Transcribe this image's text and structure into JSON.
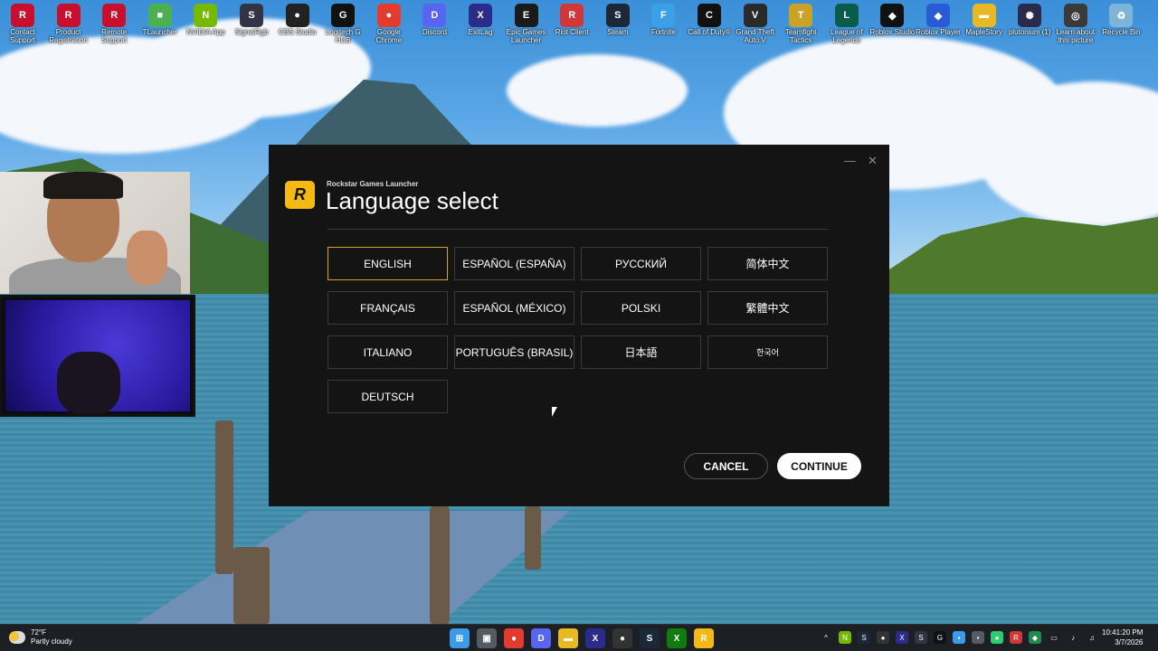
{
  "desktop_icons": [
    {
      "label": "Contact Support",
      "icon": "rockstar-icon",
      "color": "#c8102e",
      "glyph": "R"
    },
    {
      "label": "Product Registration",
      "icon": "rockstar-icon",
      "color": "#c8102e",
      "glyph": "R"
    },
    {
      "label": "Remote Support",
      "icon": "rockstar-icon",
      "color": "#c8102e",
      "glyph": "R"
    },
    {
      "label": "TLauncher",
      "icon": "tlauncher-icon",
      "color": "#4caf50",
      "glyph": "■"
    },
    {
      "label": "NVIDIA App",
      "icon": "nvidia-icon",
      "color": "#76b900",
      "glyph": "N"
    },
    {
      "label": "SignalRgb",
      "icon": "signalrgb-icon",
      "color": "#333344",
      "glyph": "S"
    },
    {
      "label": "OBS Studio",
      "icon": "obs-icon",
      "color": "#222222",
      "glyph": "●"
    },
    {
      "label": "Logitech G HUB",
      "icon": "logitech-icon",
      "color": "#111111",
      "glyph": "G"
    },
    {
      "label": "Google Chrome",
      "icon": "chrome-icon",
      "color": "#e33b2e",
      "glyph": "●"
    },
    {
      "label": "Discord",
      "icon": "discord-icon",
      "color": "#5865f2",
      "glyph": "D"
    },
    {
      "label": "ExitLag",
      "icon": "exitlag-icon",
      "color": "#2b2b8c",
      "glyph": "X"
    },
    {
      "label": "Epic Games Launcher",
      "icon": "epic-icon",
      "color": "#1a1a1a",
      "glyph": "E"
    },
    {
      "label": "Riot Client",
      "icon": "riot-icon",
      "color": "#d13639",
      "glyph": "R"
    },
    {
      "label": "Steam",
      "icon": "steam-icon",
      "color": "#1b2838",
      "glyph": "S"
    },
    {
      "label": "Fortnite",
      "icon": "fortnite-icon",
      "color": "#3aa0e8",
      "glyph": "F"
    },
    {
      "label": "Call of Duty®",
      "icon": "cod-icon",
      "color": "#111111",
      "glyph": "C"
    },
    {
      "label": "Grand Theft Auto V",
      "icon": "gta-icon",
      "color": "#2a2a2a",
      "glyph": "V"
    },
    {
      "label": "Teamfight Tactics",
      "icon": "tft-icon",
      "color": "#c9a227",
      "glyph": "T"
    },
    {
      "label": "League of Legends",
      "icon": "lol-icon",
      "color": "#0a5c4a",
      "glyph": "L"
    },
    {
      "label": "Roblox Studio",
      "icon": "roblox-studio-icon",
      "color": "#111111",
      "glyph": "◆"
    },
    {
      "label": "Roblox Player",
      "icon": "roblox-player-icon",
      "color": "#2a5bd7",
      "glyph": "◆"
    },
    {
      "label": "MapleStory",
      "icon": "folder-icon",
      "color": "#e8b923",
      "glyph": "▬"
    },
    {
      "label": "plutonium (1)",
      "icon": "plutonium-icon",
      "color": "#2a2a4a",
      "glyph": "✺"
    },
    {
      "label": "Learn about this picture",
      "icon": "learn-picture-icon",
      "color": "#3a3a3a",
      "glyph": "◎"
    },
    {
      "label": "Recycle Bin",
      "icon": "recycle-bin-icon",
      "color": "#7fb4d9",
      "glyph": "♻"
    }
  ],
  "launcher": {
    "app_name": "Rockstar Games Launcher",
    "title": "Language select",
    "logo_glyph": "R",
    "minimize_glyph": "—",
    "close_glyph": "✕",
    "accent_color": "#d4a52a",
    "selected_language": "ENGLISH",
    "languages": [
      "ENGLISH",
      "ESPAÑOL (ESPAÑA)",
      "РУССКИЙ",
      "简体中文",
      "FRANÇAIS",
      "ESPAÑOL (MÉXICO)",
      "POLSKI",
      "繁體中文",
      "ITALIANO",
      "PORTUGUÊS (BRASIL)",
      "日本語",
      "한국어",
      "DEUTSCH"
    ],
    "cancel_label": "CANCEL",
    "continue_label": "CONTINUE"
  },
  "taskbar": {
    "weather_temp": "72°F",
    "weather_desc": "Partly cloudy",
    "pinned": [
      {
        "name": "start-icon",
        "color": "#3b9be8",
        "glyph": "⊞"
      },
      {
        "name": "task-view-icon",
        "color": "#555b63",
        "glyph": "▣"
      },
      {
        "name": "chrome-icon",
        "color": "#e33b2e",
        "glyph": "●"
      },
      {
        "name": "discord-icon",
        "color": "#5865f2",
        "glyph": "D"
      },
      {
        "name": "file-explorer-icon",
        "color": "#e8b923",
        "glyph": "▬"
      },
      {
        "name": "exitlag-icon",
        "color": "#2b2b8c",
        "glyph": "X"
      },
      {
        "name": "obs-icon",
        "color": "#333333",
        "glyph": "●"
      },
      {
        "name": "steam-icon",
        "color": "#1b2838",
        "glyph": "S"
      },
      {
        "name": "xbox-icon",
        "color": "#107c10",
        "glyph": "X"
      },
      {
        "name": "rockstar-launcher-icon",
        "color": "#f5b915",
        "glyph": "R"
      }
    ],
    "tray": [
      {
        "name": "chevron-up-icon",
        "color": "#1c1f24",
        "glyph": "^"
      },
      {
        "name": "nvidia-tray-icon",
        "color": "#76b900",
        "glyph": "N"
      },
      {
        "name": "steam-tray-icon",
        "color": "#1b2838",
        "glyph": "S"
      },
      {
        "name": "obs-tray-icon",
        "color": "#333333",
        "glyph": "●"
      },
      {
        "name": "exitlag-tray-icon",
        "color": "#2b2b8c",
        "glyph": "X"
      },
      {
        "name": "signalrgb-tray-icon",
        "color": "#333344",
        "glyph": "S"
      },
      {
        "name": "logitech-tray-icon",
        "color": "#111111",
        "glyph": "G"
      },
      {
        "name": "app-tray-icon",
        "color": "#3b9be8",
        "glyph": "▪"
      },
      {
        "name": "app2-tray-icon",
        "color": "#555b63",
        "glyph": "▪"
      },
      {
        "name": "status-tray-icon",
        "color": "#2ecc71",
        "glyph": "●"
      },
      {
        "name": "riot-tray-icon",
        "color": "#d13639",
        "glyph": "R"
      },
      {
        "name": "defender-tray-icon",
        "color": "#1f8a4c",
        "glyph": "◆"
      },
      {
        "name": "network-tray-icon",
        "color": "#1c1f24",
        "glyph": "▭"
      },
      {
        "name": "mic-tray-icon",
        "color": "#1c1f24",
        "glyph": "♪"
      },
      {
        "name": "volume-tray-icon",
        "color": "#1c1f24",
        "glyph": "♫"
      }
    ],
    "time": "10:41:20 PM",
    "date": "3/7/2026"
  }
}
